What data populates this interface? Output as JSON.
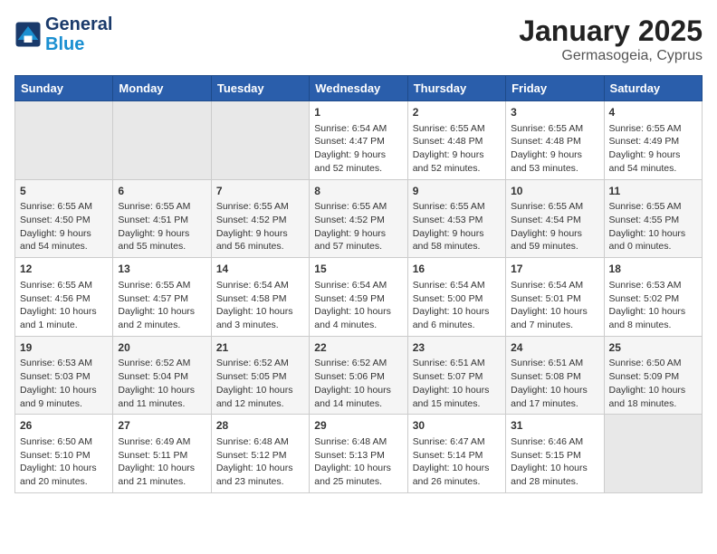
{
  "header": {
    "logo_line1": "General",
    "logo_line2": "Blue",
    "main_title": "January 2025",
    "subtitle": "Germasogeia, Cyprus"
  },
  "days_of_week": [
    "Sunday",
    "Monday",
    "Tuesday",
    "Wednesday",
    "Thursday",
    "Friday",
    "Saturday"
  ],
  "weeks": [
    [
      {
        "day": "",
        "content": ""
      },
      {
        "day": "",
        "content": ""
      },
      {
        "day": "",
        "content": ""
      },
      {
        "day": "1",
        "content": "Sunrise: 6:54 AM\nSunset: 4:47 PM\nDaylight: 9 hours\nand 52 minutes."
      },
      {
        "day": "2",
        "content": "Sunrise: 6:55 AM\nSunset: 4:48 PM\nDaylight: 9 hours\nand 52 minutes."
      },
      {
        "day": "3",
        "content": "Sunrise: 6:55 AM\nSunset: 4:48 PM\nDaylight: 9 hours\nand 53 minutes."
      },
      {
        "day": "4",
        "content": "Sunrise: 6:55 AM\nSunset: 4:49 PM\nDaylight: 9 hours\nand 54 minutes."
      }
    ],
    [
      {
        "day": "5",
        "content": "Sunrise: 6:55 AM\nSunset: 4:50 PM\nDaylight: 9 hours\nand 54 minutes."
      },
      {
        "day": "6",
        "content": "Sunrise: 6:55 AM\nSunset: 4:51 PM\nDaylight: 9 hours\nand 55 minutes."
      },
      {
        "day": "7",
        "content": "Sunrise: 6:55 AM\nSunset: 4:52 PM\nDaylight: 9 hours\nand 56 minutes."
      },
      {
        "day": "8",
        "content": "Sunrise: 6:55 AM\nSunset: 4:52 PM\nDaylight: 9 hours\nand 57 minutes."
      },
      {
        "day": "9",
        "content": "Sunrise: 6:55 AM\nSunset: 4:53 PM\nDaylight: 9 hours\nand 58 minutes."
      },
      {
        "day": "10",
        "content": "Sunrise: 6:55 AM\nSunset: 4:54 PM\nDaylight: 9 hours\nand 59 minutes."
      },
      {
        "day": "11",
        "content": "Sunrise: 6:55 AM\nSunset: 4:55 PM\nDaylight: 10 hours\nand 0 minutes."
      }
    ],
    [
      {
        "day": "12",
        "content": "Sunrise: 6:55 AM\nSunset: 4:56 PM\nDaylight: 10 hours\nand 1 minute."
      },
      {
        "day": "13",
        "content": "Sunrise: 6:55 AM\nSunset: 4:57 PM\nDaylight: 10 hours\nand 2 minutes."
      },
      {
        "day": "14",
        "content": "Sunrise: 6:54 AM\nSunset: 4:58 PM\nDaylight: 10 hours\nand 3 minutes."
      },
      {
        "day": "15",
        "content": "Sunrise: 6:54 AM\nSunset: 4:59 PM\nDaylight: 10 hours\nand 4 minutes."
      },
      {
        "day": "16",
        "content": "Sunrise: 6:54 AM\nSunset: 5:00 PM\nDaylight: 10 hours\nand 6 minutes."
      },
      {
        "day": "17",
        "content": "Sunrise: 6:54 AM\nSunset: 5:01 PM\nDaylight: 10 hours\nand 7 minutes."
      },
      {
        "day": "18",
        "content": "Sunrise: 6:53 AM\nSunset: 5:02 PM\nDaylight: 10 hours\nand 8 minutes."
      }
    ],
    [
      {
        "day": "19",
        "content": "Sunrise: 6:53 AM\nSunset: 5:03 PM\nDaylight: 10 hours\nand 9 minutes."
      },
      {
        "day": "20",
        "content": "Sunrise: 6:52 AM\nSunset: 5:04 PM\nDaylight: 10 hours\nand 11 minutes."
      },
      {
        "day": "21",
        "content": "Sunrise: 6:52 AM\nSunset: 5:05 PM\nDaylight: 10 hours\nand 12 minutes."
      },
      {
        "day": "22",
        "content": "Sunrise: 6:52 AM\nSunset: 5:06 PM\nDaylight: 10 hours\nand 14 minutes."
      },
      {
        "day": "23",
        "content": "Sunrise: 6:51 AM\nSunset: 5:07 PM\nDaylight: 10 hours\nand 15 minutes."
      },
      {
        "day": "24",
        "content": "Sunrise: 6:51 AM\nSunset: 5:08 PM\nDaylight: 10 hours\nand 17 minutes."
      },
      {
        "day": "25",
        "content": "Sunrise: 6:50 AM\nSunset: 5:09 PM\nDaylight: 10 hours\nand 18 minutes."
      }
    ],
    [
      {
        "day": "26",
        "content": "Sunrise: 6:50 AM\nSunset: 5:10 PM\nDaylight: 10 hours\nand 20 minutes."
      },
      {
        "day": "27",
        "content": "Sunrise: 6:49 AM\nSunset: 5:11 PM\nDaylight: 10 hours\nand 21 minutes."
      },
      {
        "day": "28",
        "content": "Sunrise: 6:48 AM\nSunset: 5:12 PM\nDaylight: 10 hours\nand 23 minutes."
      },
      {
        "day": "29",
        "content": "Sunrise: 6:48 AM\nSunset: 5:13 PM\nDaylight: 10 hours\nand 25 minutes."
      },
      {
        "day": "30",
        "content": "Sunrise: 6:47 AM\nSunset: 5:14 PM\nDaylight: 10 hours\nand 26 minutes."
      },
      {
        "day": "31",
        "content": "Sunrise: 6:46 AM\nSunset: 5:15 PM\nDaylight: 10 hours\nand 28 minutes."
      },
      {
        "day": "",
        "content": ""
      }
    ]
  ]
}
